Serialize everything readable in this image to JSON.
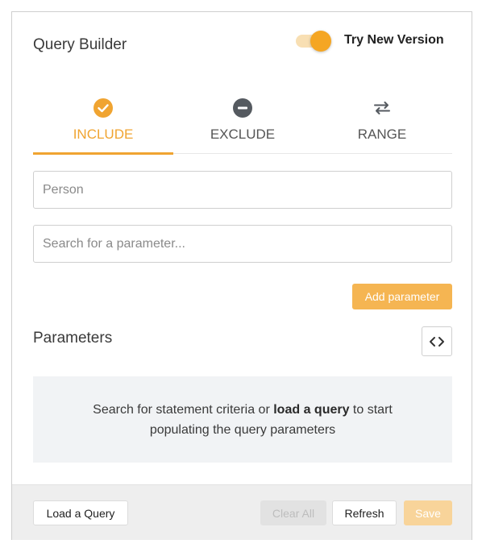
{
  "header": {
    "title": "Query Builder",
    "toggle": {
      "label": "Try New Version",
      "on": true
    }
  },
  "tabs": [
    {
      "label": "INCLUDE",
      "icon": "check-circle-icon",
      "active": true
    },
    {
      "label": "EXCLUDE",
      "icon": "minus-circle-icon",
      "active": false
    },
    {
      "label": "RANGE",
      "icon": "swap-arrows-icon",
      "active": false
    }
  ],
  "inputs": {
    "person": {
      "value": "",
      "placeholder": "Person"
    },
    "search": {
      "value": "",
      "placeholder": "Search for a parameter..."
    }
  },
  "add_parameter_label": "Add parameter",
  "parameters": {
    "title": "Parameters",
    "code_icon": "code-brackets-icon",
    "empty": {
      "text_before": "Search for statement criteria or ",
      "link": "load a query",
      "text_after": " to start populating the query parameters"
    }
  },
  "footer": {
    "load_label": "Load a Query",
    "clear_label": "Clear All",
    "refresh_label": "Refresh",
    "save_label": "Save"
  },
  "colors": {
    "accent": "#f0a431",
    "accent_light": "#f5b552",
    "disabled_save": "#f8d49a",
    "icon_dark": "#555a60"
  }
}
